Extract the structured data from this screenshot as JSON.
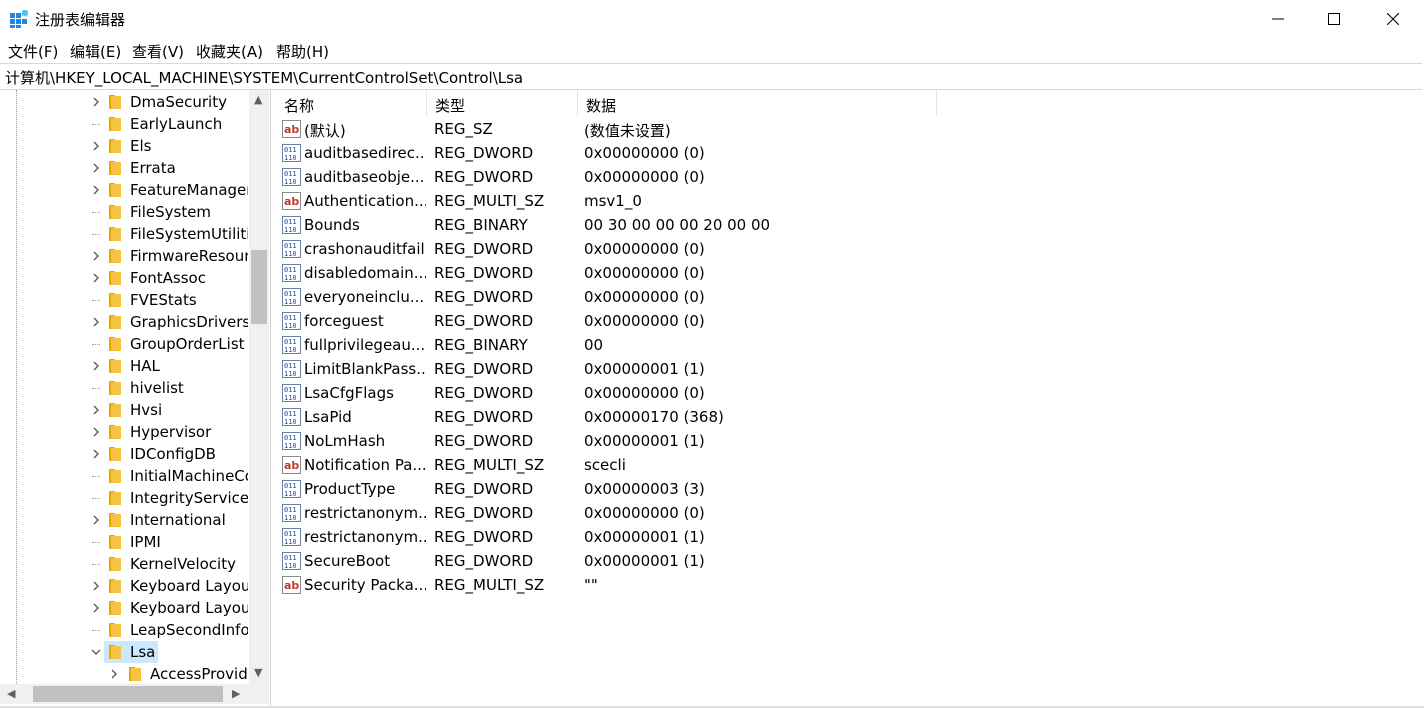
{
  "window": {
    "title": "注册表编辑器",
    "minimize_icon": "minimize-icon",
    "maximize_icon": "maximize-icon",
    "close_icon": "close-icon"
  },
  "menu": [
    "文件(F)",
    "编辑(E)",
    "查看(V)",
    "收藏夹(A)",
    "帮助(H)"
  ],
  "address": "计算机\\HKEY_LOCAL_MACHINE\\SYSTEM\\CurrentControlSet\\Control\\Lsa",
  "tree": {
    "items": [
      {
        "label": "DmaSecurity",
        "expandable": true
      },
      {
        "label": "EarlyLaunch",
        "expandable": false
      },
      {
        "label": "Els",
        "expandable": true
      },
      {
        "label": "Errata",
        "expandable": true
      },
      {
        "label": "FeatureManager",
        "expandable": true
      },
      {
        "label": "FileSystem",
        "expandable": false
      },
      {
        "label": "FileSystemUtilities",
        "expandable": false
      },
      {
        "label": "FirmwareResources",
        "expandable": true
      },
      {
        "label": "FontAssoc",
        "expandable": true
      },
      {
        "label": "FVEStats",
        "expandable": false
      },
      {
        "label": "GraphicsDrivers",
        "expandable": true
      },
      {
        "label": "GroupOrderList",
        "expandable": false
      },
      {
        "label": "HAL",
        "expandable": true
      },
      {
        "label": "hivelist",
        "expandable": false
      },
      {
        "label": "Hvsi",
        "expandable": true
      },
      {
        "label": "Hypervisor",
        "expandable": true
      },
      {
        "label": "IDConfigDB",
        "expandable": true
      },
      {
        "label": "InitialMachineConfig",
        "expandable": false
      },
      {
        "label": "IntegrityServices",
        "expandable": false
      },
      {
        "label": "International",
        "expandable": true
      },
      {
        "label": "IPMI",
        "expandable": false
      },
      {
        "label": "KernelVelocity",
        "expandable": false
      },
      {
        "label": "Keyboard Layout",
        "expandable": true
      },
      {
        "label": "Keyboard Layouts",
        "expandable": true
      },
      {
        "label": "LeapSecondInformation",
        "expandable": false
      },
      {
        "label": "Lsa",
        "expandable": true,
        "expanded": true,
        "selected": true
      },
      {
        "label": "AccessProviders",
        "expandable": true,
        "child": true
      }
    ]
  },
  "columns": {
    "name": "名称",
    "type": "类型",
    "data": "数据"
  },
  "values": [
    {
      "icon": "string",
      "name": "(默认)",
      "type": "REG_SZ",
      "data": "(数值未设置)"
    },
    {
      "icon": "binary",
      "name": "auditbasedirec...",
      "type": "REG_DWORD",
      "data": "0x00000000 (0)"
    },
    {
      "icon": "binary",
      "name": "auditbaseobje...",
      "type": "REG_DWORD",
      "data": "0x00000000 (0)"
    },
    {
      "icon": "string",
      "name": "Authentication...",
      "type": "REG_MULTI_SZ",
      "data": "msv1_0"
    },
    {
      "icon": "binary",
      "name": "Bounds",
      "type": "REG_BINARY",
      "data": "00 30 00 00 00 20 00 00"
    },
    {
      "icon": "binary",
      "name": "crashonauditfail",
      "type": "REG_DWORD",
      "data": "0x00000000 (0)"
    },
    {
      "icon": "binary",
      "name": "disabledomain...",
      "type": "REG_DWORD",
      "data": "0x00000000 (0)"
    },
    {
      "icon": "binary",
      "name": "everyoneinclu...",
      "type": "REG_DWORD",
      "data": "0x00000000 (0)"
    },
    {
      "icon": "binary",
      "name": "forceguest",
      "type": "REG_DWORD",
      "data": "0x00000000 (0)"
    },
    {
      "icon": "binary",
      "name": "fullprivilegeau...",
      "type": "REG_BINARY",
      "data": "00"
    },
    {
      "icon": "binary",
      "name": "LimitBlankPass...",
      "type": "REG_DWORD",
      "data": "0x00000001 (1)"
    },
    {
      "icon": "binary",
      "name": "LsaCfgFlags",
      "type": "REG_DWORD",
      "data": "0x00000000 (0)"
    },
    {
      "icon": "binary",
      "name": "LsaPid",
      "type": "REG_DWORD",
      "data": "0x00000170 (368)"
    },
    {
      "icon": "binary",
      "name": "NoLmHash",
      "type": "REG_DWORD",
      "data": "0x00000001 (1)"
    },
    {
      "icon": "string",
      "name": "Notification Pa...",
      "type": "REG_MULTI_SZ",
      "data": "scecli"
    },
    {
      "icon": "binary",
      "name": "ProductType",
      "type": "REG_DWORD",
      "data": "0x00000003 (3)"
    },
    {
      "icon": "binary",
      "name": "restrictanonym...",
      "type": "REG_DWORD",
      "data": "0x00000000 (0)"
    },
    {
      "icon": "binary",
      "name": "restrictanonym...",
      "type": "REG_DWORD",
      "data": "0x00000001 (1)"
    },
    {
      "icon": "binary",
      "name": "SecureBoot",
      "type": "REG_DWORD",
      "data": "0x00000001 (1)"
    },
    {
      "icon": "string",
      "name": "Security Packa...",
      "type": "REG_MULTI_SZ",
      "data": "\"\""
    }
  ],
  "colors": {
    "selection": "#cce8ff",
    "folder": "#f6c343",
    "scrollbar_thumb": "#c1c1c1"
  }
}
